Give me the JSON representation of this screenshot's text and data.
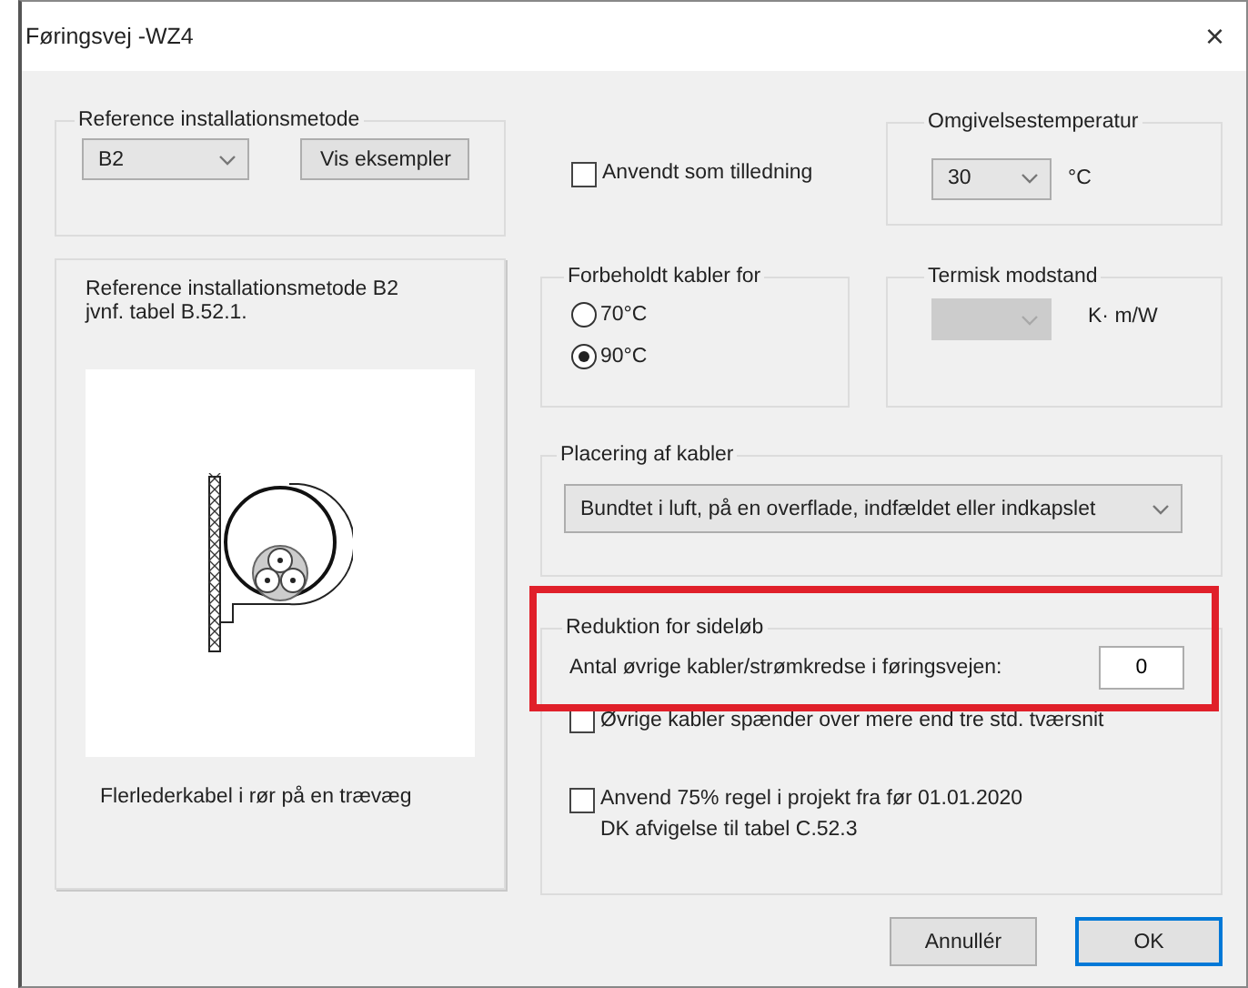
{
  "window": {
    "title": "Føringsvej -WZ4",
    "close": "×"
  },
  "reference_group": {
    "label": "Reference installationsmetode",
    "dropdown": {
      "value": "B2"
    },
    "button": "Vis eksempler"
  },
  "tilledning": {
    "label": "Anvendt som tilledning",
    "checked": false
  },
  "ambient": {
    "label": "Omgivelsestemperatur",
    "dropdown": {
      "value": "30"
    },
    "unit": "°C"
  },
  "preview": {
    "title": "Reference installationsmetode B2",
    "subtitle": "jvnf. tabel B.52.1.",
    "caption": "Flerlederkabel i rør på en trævæg"
  },
  "reserved": {
    "label": "Forbeholdt kabler for",
    "options": [
      {
        "label": "70°C",
        "selected": false
      },
      {
        "label": "90°C",
        "selected": true
      }
    ]
  },
  "thermal": {
    "label": "Termisk modstand",
    "dropdown": {
      "disabled": true
    },
    "unit": "K· m/W"
  },
  "placement": {
    "label": "Placering af kabler",
    "dropdown": {
      "value": "Bundtet i luft, på en overflade, indfældet eller indkapslet"
    }
  },
  "reduction": {
    "label": "Reduktion for sideløb",
    "highlighted": true,
    "count_label": "Antal øvrige kabler/strømkredse i føringsvejen:",
    "count_value": "0",
    "options": [
      {
        "label": "Øvrige kabler spænder over mere end tre std. tværsnit",
        "checked": false
      },
      {
        "label": "Anvend 75% regel i projekt fra før 01.01.2020",
        "note": "DK afvigelse til tabel C.52.3",
        "checked": false
      }
    ]
  },
  "buttons": [
    {
      "label": "Annullér",
      "default": false
    },
    {
      "label": "OK",
      "default": true
    }
  ]
}
